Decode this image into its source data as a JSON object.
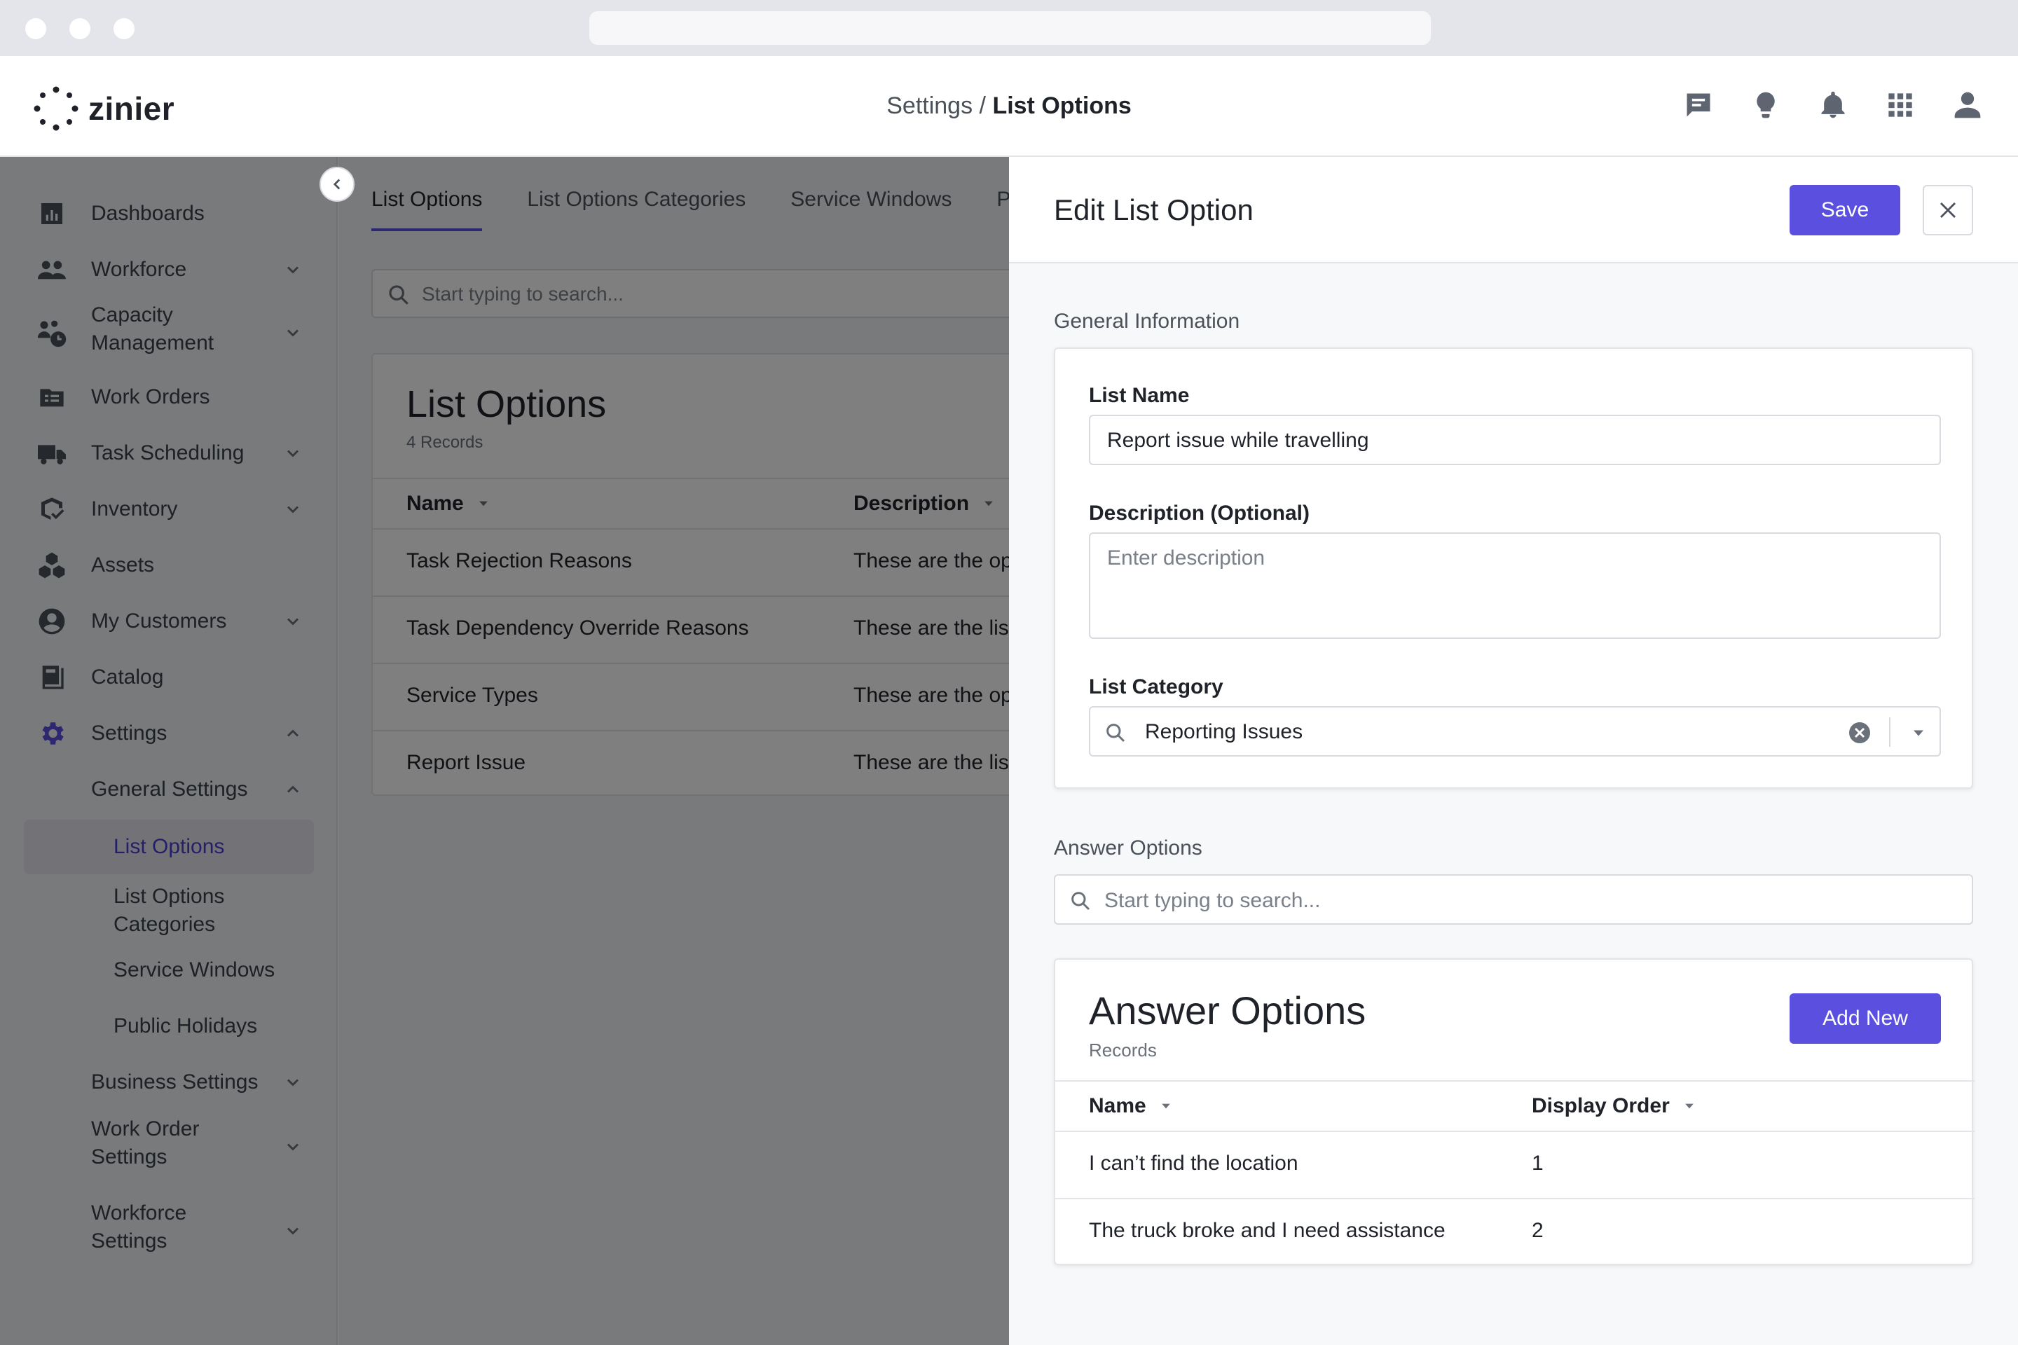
{
  "app": {
    "logo_text": "zinier"
  },
  "breadcrumb": {
    "parent": "Settings",
    "separator": " / ",
    "current": "List Options"
  },
  "header_icons": [
    "chat-icon",
    "lightbulb-icon",
    "bell-icon",
    "apps-grid-icon",
    "user-icon"
  ],
  "sidebar": {
    "items": [
      {
        "label": "Dashboards",
        "icon": "dashboard-icon"
      },
      {
        "label": "Workforce",
        "icon": "people-icon"
      },
      {
        "label": "Capacity",
        "label2": "Management",
        "icon": "capacity-icon"
      },
      {
        "label": "Work Orders",
        "icon": "work-orders-icon"
      },
      {
        "label": "Task Scheduling",
        "icon": "truck-icon"
      },
      {
        "label": "Inventory",
        "icon": "inventory-icon"
      },
      {
        "label": "Assets",
        "icon": "assets-icon"
      },
      {
        "label": "My Customers",
        "icon": "customer-icon"
      },
      {
        "label": "Catalog",
        "icon": "catalog-icon"
      },
      {
        "label": "Settings",
        "icon": "gear-icon"
      }
    ],
    "settings_children": {
      "general": "General Settings",
      "general_children": [
        "List Options",
        "List Options",
        "Service Windows",
        "Public Holidays"
      ],
      "list_options_categories_line1": "List Options",
      "list_options_categories_line2": "Categories",
      "business": "Business Settings",
      "work_order_1": "Work Order",
      "work_order_2": "Settings",
      "workforce_1": "Workforce",
      "workforce_2": "Settings"
    }
  },
  "main": {
    "tabs": [
      "List Options",
      "List Options Categories",
      "Service Windows",
      "Pu"
    ],
    "search_placeholder": "Start typing to search...",
    "card": {
      "title": "List Options",
      "records": "4 Records",
      "columns": [
        "Name",
        "Description"
      ],
      "rows": [
        {
          "name": "Task Rejection Reasons",
          "description": "These are the opt"
        },
        {
          "name": "Task Dependency Override Reasons",
          "description": "These are the list"
        },
        {
          "name": "Service Types",
          "description": "These are the opt"
        },
        {
          "name": "Report Issue",
          "description": "These are the list"
        }
      ]
    }
  },
  "drawer": {
    "title": "Edit List Option",
    "save_label": "Save",
    "general_section": "General Information",
    "list_name_label": "List Name",
    "list_name_value": "Report issue while travelling",
    "description_label": "Description (Optional)",
    "description_placeholder": "Enter description",
    "category_label": "List Category",
    "category_value": "Reporting Issues",
    "answer_section": "Answer Options",
    "answer_search_placeholder": "Start typing to search...",
    "answer_card": {
      "title": "Answer Options",
      "records": "Records",
      "add_label": "Add New",
      "columns": [
        "Name",
        "Display Order"
      ],
      "rows": [
        {
          "name": "I can’t find the location",
          "order": "1"
        },
        {
          "name": "The truck broke and I need assistance",
          "order": "2"
        }
      ]
    }
  },
  "colors": {
    "accent": "#5b4fe0",
    "overlay": "#000000"
  }
}
